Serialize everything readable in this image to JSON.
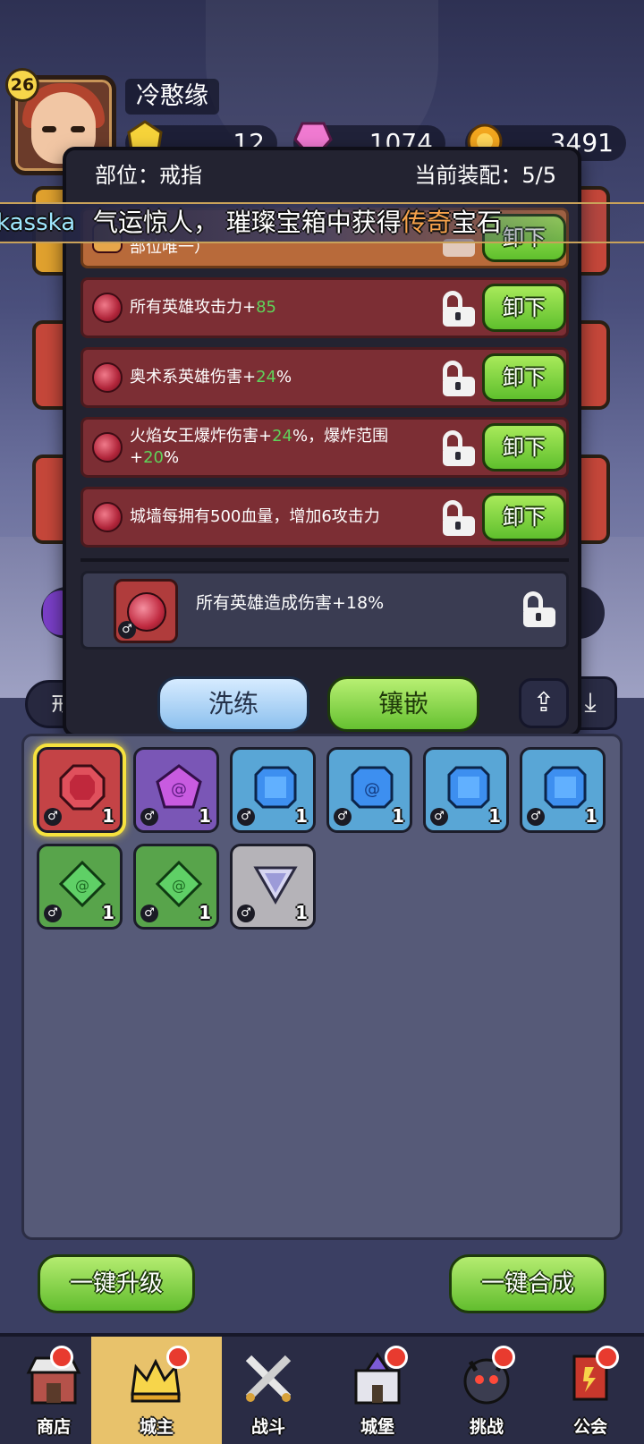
{
  "player": {
    "level": "26",
    "name": "冷憨缘",
    "currencies": [
      {
        "icon": "gold-gem-icon",
        "value": "12"
      },
      {
        "icon": "pink-crystal-icon",
        "value": "1074"
      },
      {
        "icon": "gold-coin-icon",
        "value": "3491"
      }
    ]
  },
  "marquee": {
    "user": "kasska",
    "message_prefix": "气运惊人， 璀璨宝箱中获得",
    "highlight": "传奇",
    "message_suffix": "宝石"
  },
  "modal": {
    "part_label": "部位：戒指",
    "equip_label": "当前装配：5/5",
    "rows": [
      {
        "text": "部位唯一）",
        "value": "",
        "suffix": "",
        "extra": "",
        "extra_value": "",
        "extra_suffix": "",
        "button": "卸下",
        "legendary": true
      },
      {
        "text": "所有英雄攻击力+",
        "value": "85",
        "suffix": "",
        "extra": "",
        "extra_value": "",
        "extra_suffix": "",
        "button": "卸下"
      },
      {
        "text": "奥术系英雄伤害+",
        "value": "24",
        "suffix": "%",
        "extra": "",
        "extra_value": "",
        "extra_suffix": "",
        "button": "卸下"
      },
      {
        "text": "火焰女王爆炸伤害+",
        "value": "24",
        "suffix": "%，爆炸范围+",
        "extra": "",
        "extra_value": "20",
        "extra_suffix": "%",
        "button": "卸下"
      },
      {
        "text": "城墙每拥有500血量，增加6攻击力",
        "value": "",
        "suffix": "",
        "extra": "",
        "extra_value": "",
        "extra_suffix": "",
        "button": "卸下"
      }
    ],
    "candidate_text": "所有英雄造成伤害+18%",
    "refine_button": "洗练",
    "inlay_button": "镶嵌"
  },
  "filter": {
    "selected": "戒指"
  },
  "inventory": [
    {
      "color": "red",
      "shape": "round-gem-icon",
      "count": "1",
      "selected": true
    },
    {
      "color": "purple",
      "shape": "pentagon-gem-icon",
      "count": "1"
    },
    {
      "color": "blue",
      "shape": "square-gem-icon",
      "count": "1"
    },
    {
      "color": "blue",
      "shape": "spiral-gem-icon",
      "count": "1"
    },
    {
      "color": "blue",
      "shape": "square-gem-icon",
      "count": "1"
    },
    {
      "color": "blue",
      "shape": "square-gem-icon",
      "count": "1"
    },
    {
      "color": "green",
      "shape": "diamond-gem-icon",
      "count": "1"
    },
    {
      "color": "green",
      "shape": "diamond-gem-icon",
      "count": "1"
    },
    {
      "color": "grey",
      "shape": "triangle-gem-icon",
      "count": "1"
    }
  ],
  "actions": {
    "upgrade_all": "一键升级",
    "merge_all": "一键合成"
  },
  "nav": [
    {
      "label": "商店",
      "icon": "shop-icon",
      "dot": true
    },
    {
      "label": "城主",
      "icon": "crown-icon",
      "dot": true,
      "active": true
    },
    {
      "label": "战斗",
      "icon": "crossed-swords-icon",
      "dot": false
    },
    {
      "label": "城堡",
      "icon": "castle-icon",
      "dot": true
    },
    {
      "label": "挑战",
      "icon": "monster-icon",
      "dot": true
    },
    {
      "label": "公会",
      "icon": "guild-banner-icon",
      "dot": true
    }
  ],
  "colors": {
    "green_button": "#62bd2e",
    "gem_row": "#7c2e34",
    "highlight": "#f6a24b",
    "stat_value": "#5fd35a"
  }
}
